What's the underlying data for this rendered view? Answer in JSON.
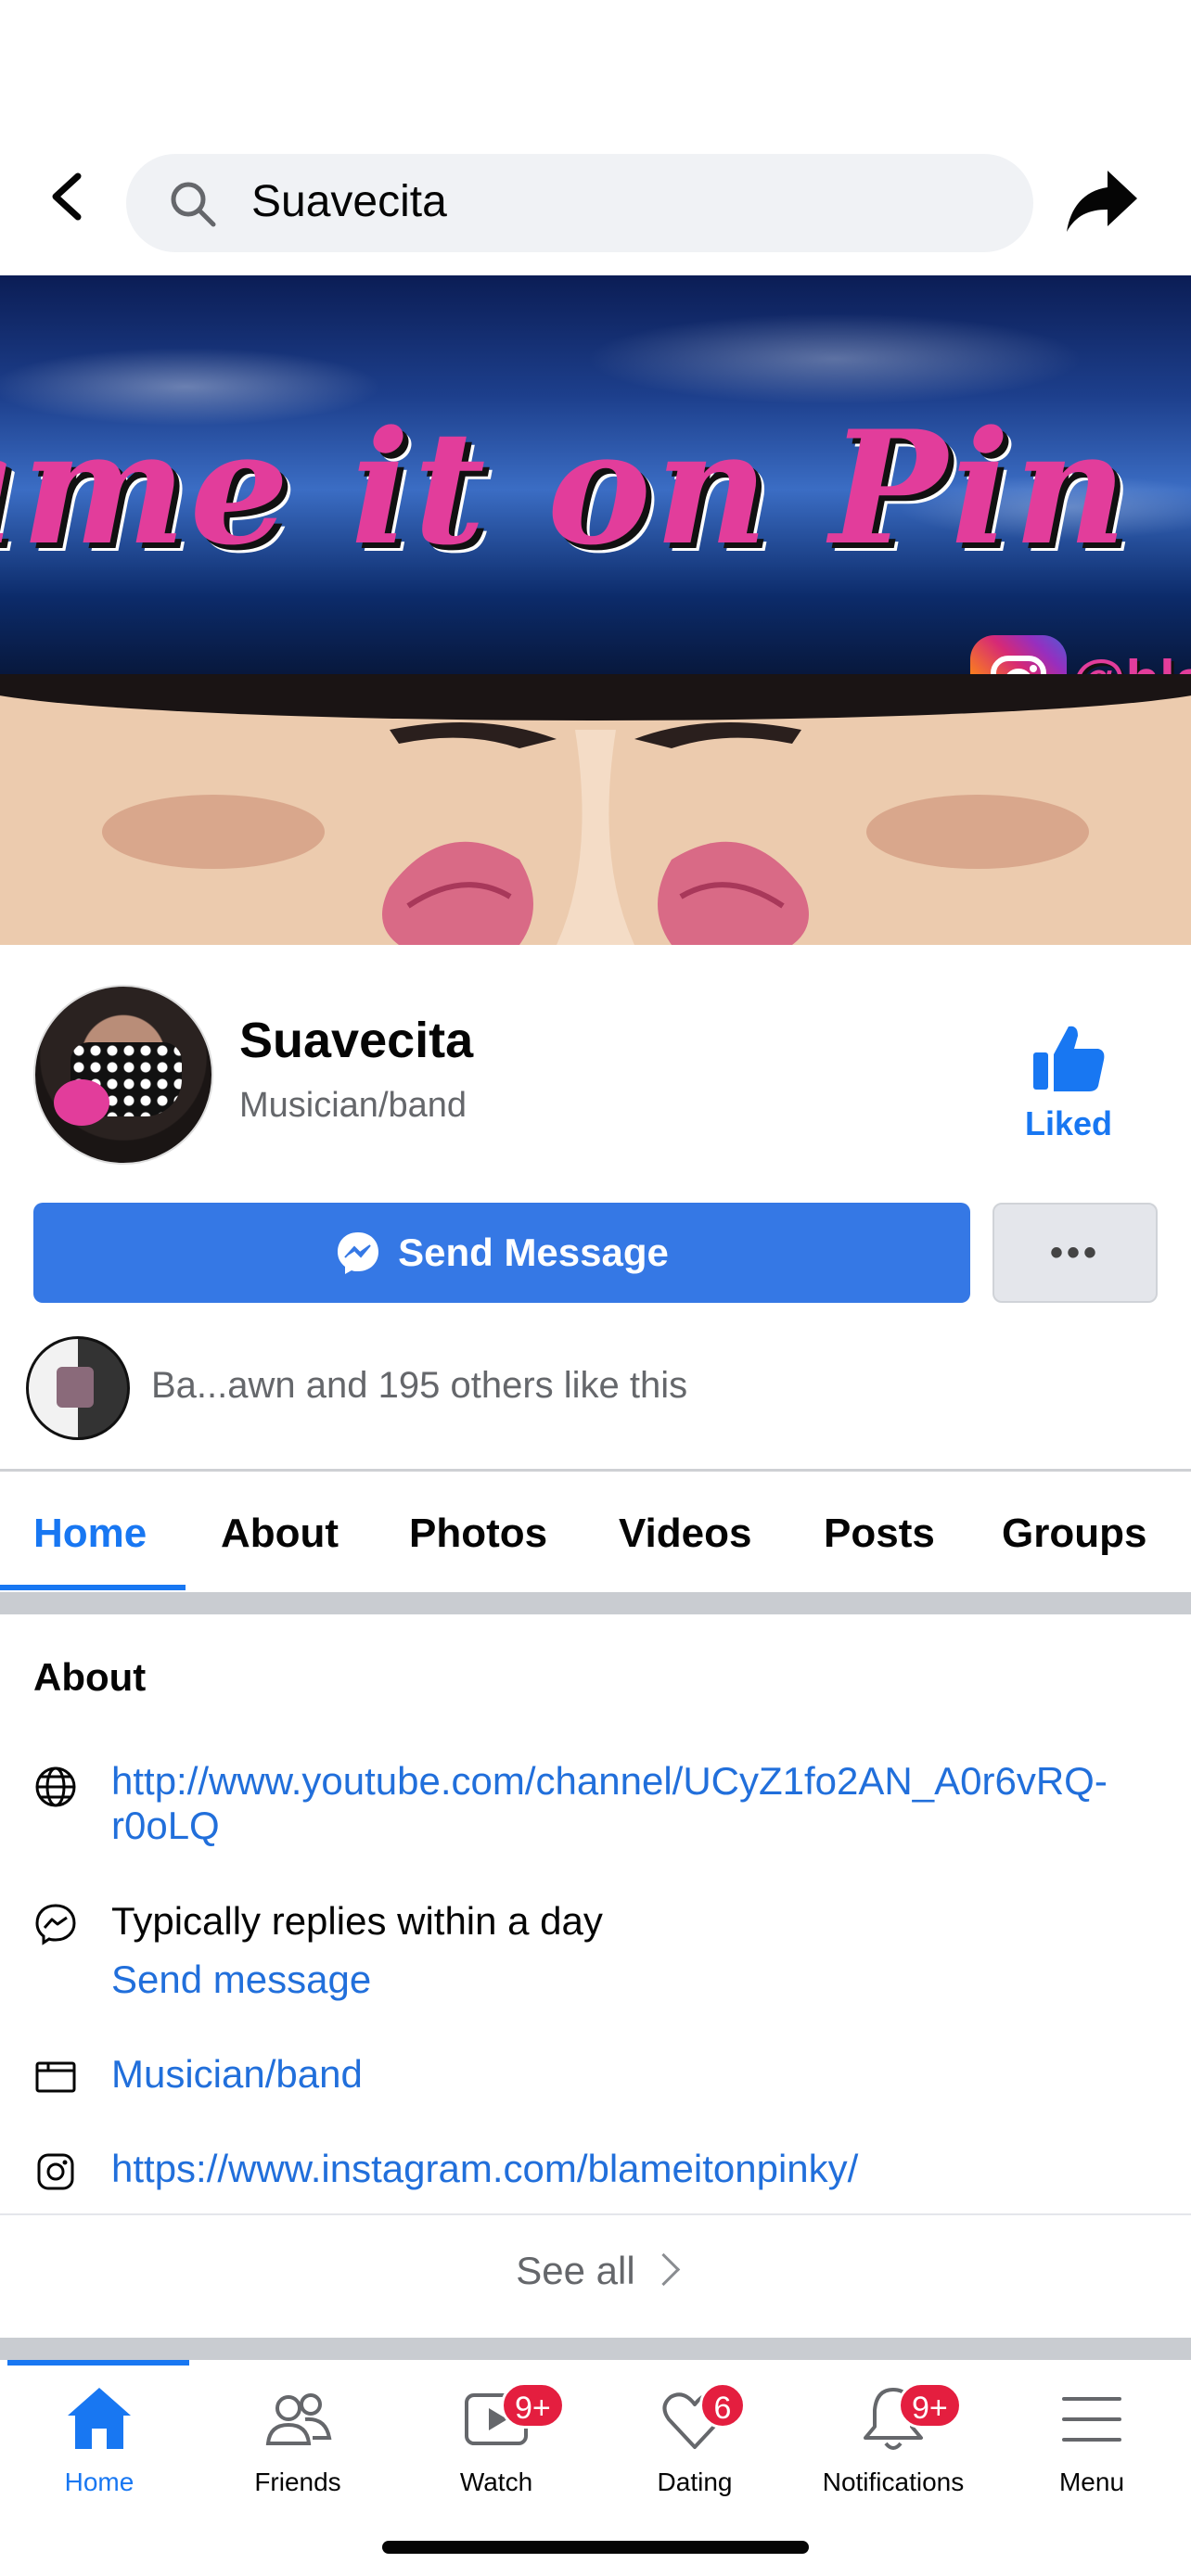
{
  "search": {
    "query": "Suavecita"
  },
  "cover": {
    "banner_text": "ame it on Pin",
    "ig_handle": "@bla"
  },
  "profile": {
    "name": "Suavecita",
    "category": "Musician/band",
    "like_label": "Liked",
    "send_message_label": "Send Message",
    "more_label": "•••",
    "friends_like_text": "Ba...awn and 195 others like this"
  },
  "tabs": [
    {
      "label": "Home",
      "active": true
    },
    {
      "label": "About"
    },
    {
      "label": "Photos"
    },
    {
      "label": "Videos"
    },
    {
      "label": "Posts"
    },
    {
      "label": "Groups"
    }
  ],
  "about": {
    "title": "About",
    "website": "http://www.youtube.com/channel/UCyZ1fo2AN_A0r6vRQ-",
    "website_cont": "r0oLQ",
    "response_time": "Typically replies within a day",
    "send_message_link": "Send message",
    "category_link": "Musician/band",
    "instagram": "https://www.instagram.com/blameitonpinky/",
    "see_all": "See all"
  },
  "bottom_nav": [
    {
      "label": "Home",
      "icon": "home-icon",
      "active": true
    },
    {
      "label": "Friends",
      "icon": "friends-icon"
    },
    {
      "label": "Watch",
      "icon": "watch-icon",
      "badge": "9+"
    },
    {
      "label": "Dating",
      "icon": "dating-icon",
      "badge": "6"
    },
    {
      "label": "Notifications",
      "icon": "bell-icon",
      "badge": "9+"
    },
    {
      "label": "Menu",
      "icon": "menu-icon"
    }
  ],
  "colors": {
    "accent": "#1877F2",
    "button": "#3578E5",
    "badge": "#E41E3F"
  }
}
